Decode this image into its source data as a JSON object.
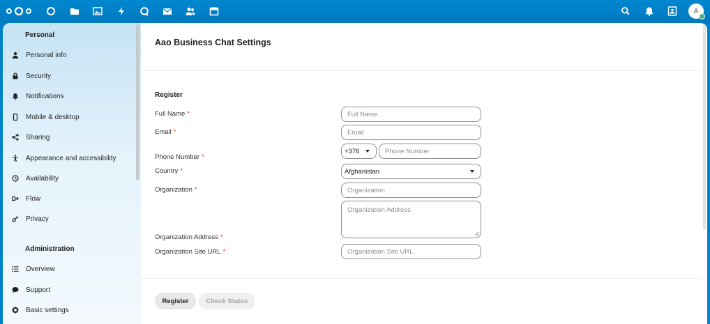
{
  "topbar": {
    "apps": [
      {
        "name": "dashboard-icon"
      },
      {
        "name": "files-icon"
      },
      {
        "name": "photos-icon"
      },
      {
        "name": "activity-icon"
      },
      {
        "name": "talk-icon"
      },
      {
        "name": "mail-icon"
      },
      {
        "name": "contacts-icon"
      },
      {
        "name": "calendar-icon"
      }
    ],
    "right_icons": [
      "search-icon",
      "notifications-icon",
      "contacts-menu-icon"
    ],
    "avatar_initial": "A",
    "accent_color": "#0082c9"
  },
  "sidebar": {
    "personal_heading": "Personal",
    "personal_items": [
      {
        "label": "Personal info",
        "icon": "user-icon"
      },
      {
        "label": "Security",
        "icon": "lock-icon"
      },
      {
        "label": "Notifications",
        "icon": "bell-icon"
      },
      {
        "label": "Mobile & desktop",
        "icon": "phone-icon"
      },
      {
        "label": "Sharing",
        "icon": "share-icon"
      },
      {
        "label": "Appearance and accessibility",
        "icon": "accessibility-icon"
      },
      {
        "label": "Availability",
        "icon": "clock-icon"
      },
      {
        "label": "Flow",
        "icon": "flow-icon"
      },
      {
        "label": "Privacy",
        "icon": "key-icon"
      }
    ],
    "admin_heading": "Administration",
    "admin_items": [
      {
        "label": "Overview",
        "icon": "list-icon"
      },
      {
        "label": "Support",
        "icon": "chat-icon"
      },
      {
        "label": "Basic settings",
        "icon": "gear-icon"
      }
    ]
  },
  "main": {
    "title": "Aao Business Chat Settings",
    "section_title": "Register",
    "required_marker": "*",
    "labels": {
      "full_name": "Full Name",
      "email": "Email",
      "phone": "Phone Number",
      "country": "Country",
      "organization": "Organization",
      "org_address": "Organization Address",
      "org_url": "Organization Site URL"
    },
    "placeholders": {
      "full_name": "Full Name",
      "email": "Email",
      "phone": "Phone Number",
      "organization": "Organization",
      "org_address": "Organization Address",
      "org_url": "Organization Site URL"
    },
    "phone_code": "+376",
    "country_value": "Afghanistan",
    "buttons": {
      "register": "Register",
      "check_status": "Check Status"
    },
    "required_color": "#e9322d"
  }
}
